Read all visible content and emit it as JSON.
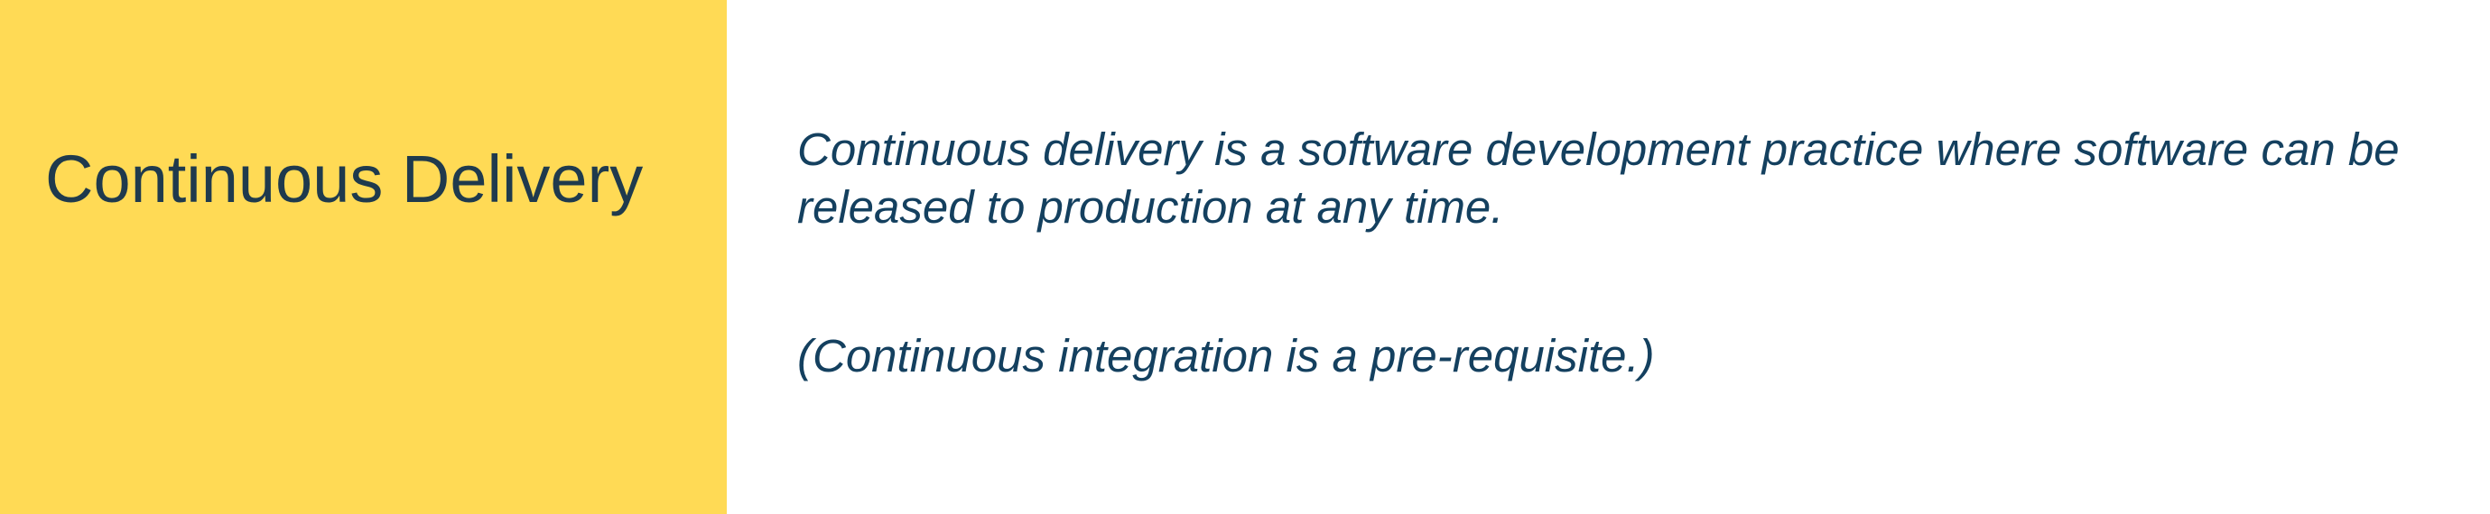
{
  "slide": {
    "title": "Continuous Delivery",
    "paragraphs": [
      "Continuous delivery is a software development practice where software can be released to production at any time.",
      "(Continuous integration is a pre-requisite.)"
    ]
  },
  "colors": {
    "left_panel_background": "#FFDA55",
    "title_text": "#1F3A4D",
    "body_text": "#14405F",
    "background": "#FFFFFF"
  }
}
